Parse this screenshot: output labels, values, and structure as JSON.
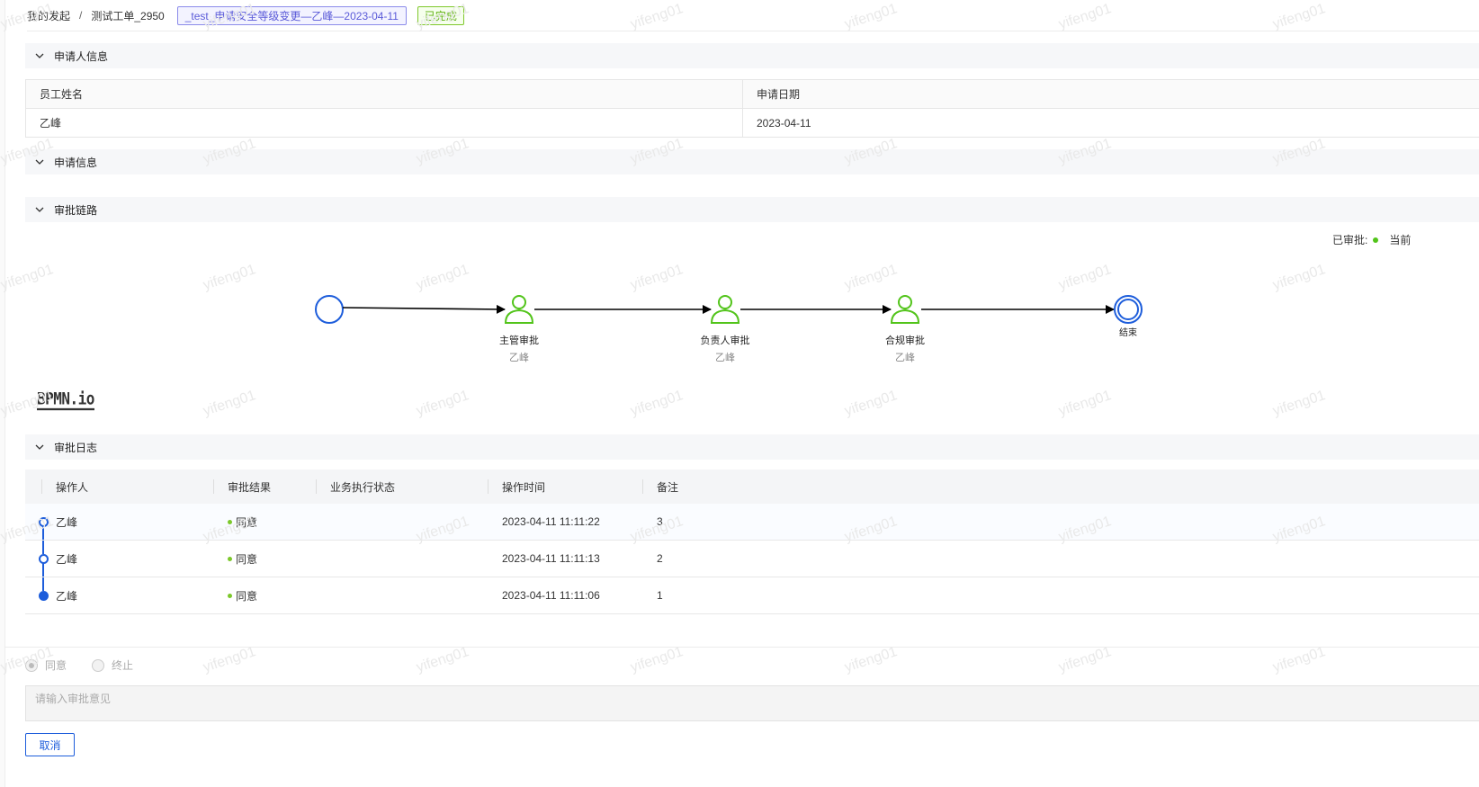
{
  "breadcrumb": {
    "root": "我的发起",
    "separator": "/",
    "current": "测试工单_2950",
    "title_tag": "_test_申请安全等级变更—乙峰—2023-04-11",
    "status": "已完成"
  },
  "sections": {
    "applicant": "申请人信息",
    "application": "申请信息",
    "approval_chain": "审批链路",
    "approval_log": "审批日志"
  },
  "applicant_table": {
    "headers": [
      "员工姓名",
      "申请日期"
    ],
    "values": [
      "乙峰",
      "2023-04-11"
    ]
  },
  "flow": {
    "legend": {
      "approved": "已审批:",
      "current": "当前"
    },
    "nodes": [
      {
        "label": "主管审批",
        "assignee": "乙峰"
      },
      {
        "label": "负责人审批",
        "assignee": "乙峰"
      },
      {
        "label": "合规审批",
        "assignee": "乙峰"
      }
    ],
    "end_label": "结束",
    "logo": "BPMN.io",
    "colors": {
      "start": "#1d5ddb",
      "task": "#52c41a",
      "end": "#1d5ddb"
    }
  },
  "log": {
    "headers": [
      "操作人",
      "审批结果",
      "业务执行状态",
      "操作时间",
      "备注"
    ],
    "rows": [
      {
        "operator": "乙峰",
        "result": "同意",
        "status": "",
        "time": "2023-04-11 11:11:22",
        "remark": "3"
      },
      {
        "operator": "乙峰",
        "result": "同意",
        "status": "",
        "time": "2023-04-11 11:11:13",
        "remark": "2"
      },
      {
        "operator": "乙峰",
        "result": "同意",
        "status": "",
        "time": "2023-04-11 11:11:06",
        "remark": "1"
      }
    ]
  },
  "form": {
    "options": [
      "同意",
      "终止"
    ],
    "selected": "同意",
    "comment_placeholder": "请输入审批意见",
    "cancel_label": "取消"
  },
  "watermark": "yifeng01",
  "colors": {
    "accent": "#1d5ddb",
    "success": "#52c41a",
    "tag_purple": "#5a5ad8"
  }
}
